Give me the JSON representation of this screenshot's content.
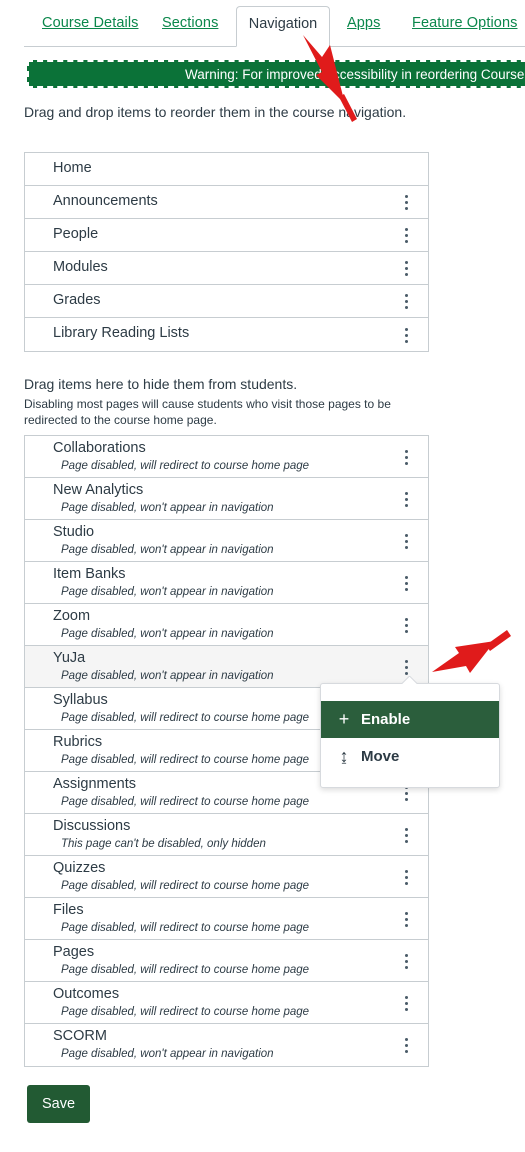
{
  "tabs": [
    {
      "label": "Course Details",
      "active": false
    },
    {
      "label": "Sections",
      "active": false
    },
    {
      "label": "Navigation",
      "active": true
    },
    {
      "label": "Apps",
      "active": false
    },
    {
      "label": "Feature Options",
      "active": false
    }
  ],
  "warning": {
    "text": "Warning: For improved accessibility in reordering Course"
  },
  "instructions": {
    "reorder": "Drag and drop items to reorder them in the course navigation.",
    "hide_heading": "Drag items here to hide them from students.",
    "hide_subtext": "Disabling most pages will cause students who visit those pages to be redirected to the course home page."
  },
  "enabled_items": [
    {
      "title": "Home",
      "has_menu": false
    },
    {
      "title": "Announcements",
      "has_menu": true
    },
    {
      "title": "People",
      "has_menu": true
    },
    {
      "title": "Modules",
      "has_menu": true
    },
    {
      "title": "Grades",
      "has_menu": true
    },
    {
      "title": "Library Reading Lists",
      "has_menu": true
    }
  ],
  "disabled_items": [
    {
      "title": "Collaborations",
      "status": "Page disabled, will redirect to course home page",
      "hovered": false
    },
    {
      "title": "New Analytics",
      "status": "Page disabled, won't appear in navigation",
      "hovered": false
    },
    {
      "title": "Studio",
      "status": "Page disabled, won't appear in navigation",
      "hovered": false
    },
    {
      "title": "Item Banks",
      "status": "Page disabled, won't appear in navigation",
      "hovered": false
    },
    {
      "title": "Zoom",
      "status": "Page disabled, won't appear in navigation",
      "hovered": false
    },
    {
      "title": "YuJa",
      "status": "Page disabled, won't appear in navigation",
      "hovered": true
    },
    {
      "title": "Syllabus",
      "status": "Page disabled, will redirect to course home page",
      "hovered": false
    },
    {
      "title": "Rubrics",
      "status": "Page disabled, will redirect to course home page",
      "hovered": false
    },
    {
      "title": "Assignments",
      "status": "Page disabled, will redirect to course home page",
      "hovered": false
    },
    {
      "title": "Discussions",
      "status": "This page can't be disabled, only hidden",
      "hovered": false
    },
    {
      "title": "Quizzes",
      "status": "Page disabled, will redirect to course home page",
      "hovered": false
    },
    {
      "title": "Files",
      "status": "Page disabled, will redirect to course home page",
      "hovered": false
    },
    {
      "title": "Pages",
      "status": "Page disabled, will redirect to course home page",
      "hovered": false
    },
    {
      "title": "Outcomes",
      "status": "Page disabled, will redirect to course home page",
      "hovered": false
    },
    {
      "title": "SCORM",
      "status": "Page disabled, won't appear in navigation",
      "hovered": false
    }
  ],
  "popup_menu": {
    "items": [
      {
        "label": "Enable",
        "icon": "+",
        "icon_name": "plus-icon",
        "selected": true
      },
      {
        "label": "Move",
        "icon": "↨",
        "icon_name": "move-updown-icon",
        "selected": false
      }
    ]
  },
  "save": {
    "label": "Save"
  },
  "colors": {
    "tab_link": "#0b874b",
    "warning_bg": "#0b7238",
    "menu_selected_bg": "#2b5e3c",
    "save_bg": "#225a33",
    "annotation_arrow": "#e01b1b",
    "border": "#c7cdd1"
  }
}
